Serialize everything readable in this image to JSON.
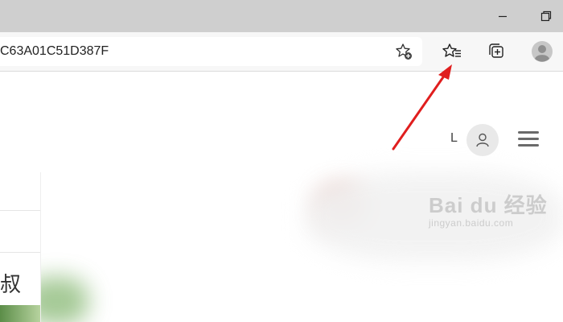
{
  "browser": {
    "url_text": "C63A01C51D387F",
    "icons": {
      "minimize": "minimize-icon",
      "restore": "restore-icon",
      "add_favorite": "star-plus-icon",
      "favorites": "favorites-list-icon",
      "collections": "collections-icon",
      "profile": "profile-avatar-icon"
    }
  },
  "page": {
    "user_initial": "L",
    "menu_icon": "hamburger-menu-icon",
    "left_text": "叔"
  },
  "watermark": {
    "brand": "Bai du 经验",
    "site": "jingyan.baidu.com"
  },
  "annotation": {
    "arrow_color": "#e01e1e"
  }
}
